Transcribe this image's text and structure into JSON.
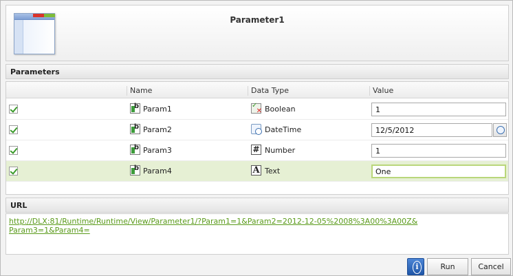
{
  "header": {
    "title": "Parameter1"
  },
  "parameters": {
    "section_label": "Parameters",
    "columns": {
      "name": "Name",
      "data_type": "Data Type",
      "value": "Value"
    },
    "rows": [
      {
        "checked": true,
        "name": "Param1",
        "type": "Boolean",
        "type_icon": "boolean-icon",
        "value": "1"
      },
      {
        "checked": true,
        "name": "Param2",
        "type": "DateTime",
        "type_icon": "datetime-icon",
        "value": "12/5/2012"
      },
      {
        "checked": true,
        "name": "Param3",
        "type": "Number",
        "type_icon": "number-icon",
        "value": "1"
      },
      {
        "checked": true,
        "name": "Param4",
        "type": "Text",
        "type_icon": "text-icon",
        "value": "One",
        "selected": true
      }
    ]
  },
  "url": {
    "section_label": "URL",
    "link": "http://DLX:81/Runtime/Runtime/View/Parameter1/?Param1=1&Param2=2012-12-05%2008%3A00%3A00Z&Param3=1&Param4="
  },
  "footer": {
    "run_label": "Run",
    "cancel_label": "Cancel"
  },
  "colors": {
    "accent_green": "#5a9a1a",
    "selected_row": "#e6f0d4",
    "info_blue": "#1f56a8"
  }
}
